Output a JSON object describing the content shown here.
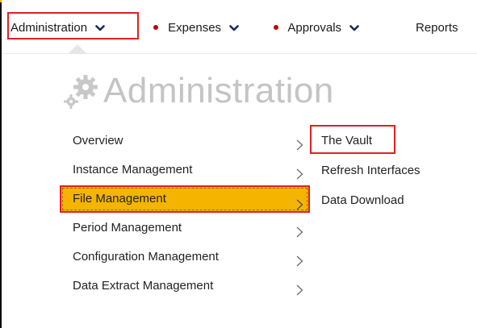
{
  "topnav": {
    "items": [
      {
        "label": "Administration",
        "has_dot": false,
        "has_chevron": true,
        "icon": "chevron-down-icon"
      },
      {
        "label": "Expenses",
        "has_dot": true,
        "has_chevron": true,
        "icon": "chevron-down-icon"
      },
      {
        "label": "Approvals",
        "has_dot": true,
        "has_chevron": true,
        "icon": "chevron-down-icon"
      },
      {
        "label": "Reports",
        "has_dot": false,
        "has_chevron": false
      }
    ],
    "dot_color": "#c00000",
    "highlight_color": "#e02020"
  },
  "panel": {
    "title": "Administration",
    "title_icon": "gears-icon",
    "menu": [
      {
        "label": "Overview",
        "icon": "chevron-right-icon",
        "active": false
      },
      {
        "label": "Instance Management",
        "icon": "chevron-right-icon",
        "active": false
      },
      {
        "label": "File Management",
        "icon": "chevron-right-icon",
        "active": true
      },
      {
        "label": "Period Management",
        "icon": "chevron-right-icon",
        "active": false
      },
      {
        "label": "Configuration Management",
        "icon": "chevron-right-icon",
        "active": false
      },
      {
        "label": "Data Extract Management",
        "icon": "chevron-right-icon",
        "active": false
      }
    ],
    "submenu": [
      {
        "label": "The Vault",
        "highlighted": true
      },
      {
        "label": "Refresh Interfaces",
        "highlighted": false
      },
      {
        "label": "Data Download",
        "highlighted": false
      }
    ],
    "active_color": "#f5b400"
  }
}
